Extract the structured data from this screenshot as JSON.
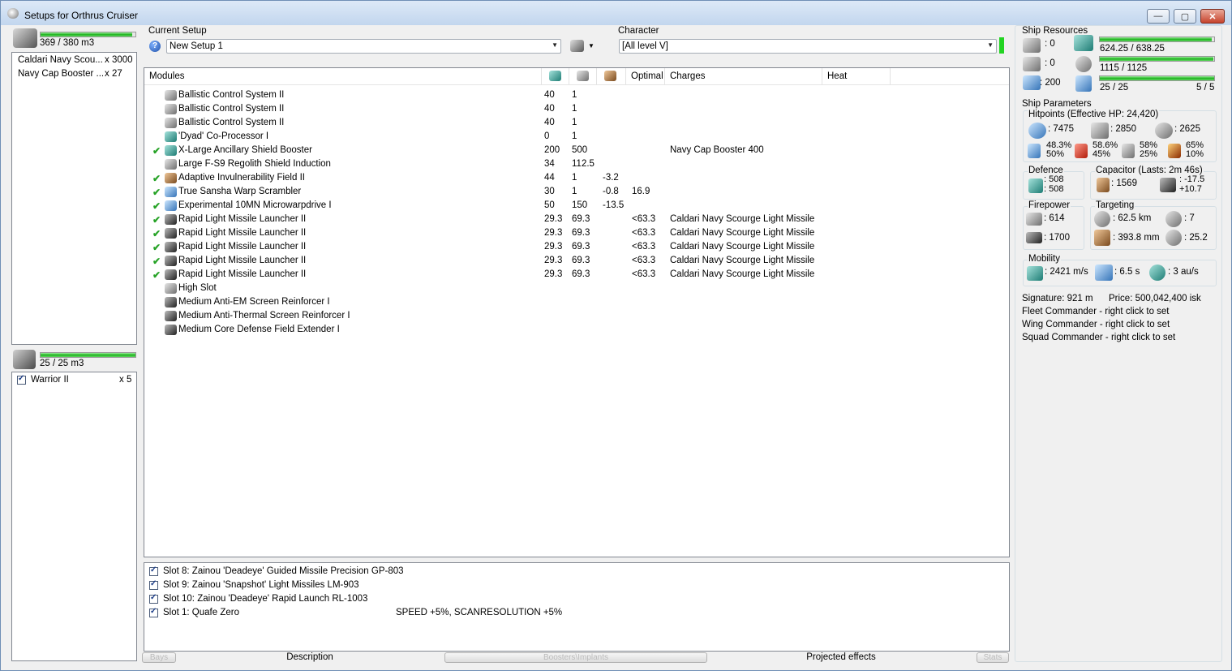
{
  "window": {
    "title": "Setups for Orthrus Cruiser",
    "minimize": "—",
    "maximize": "▢",
    "close": "✕"
  },
  "cargo": {
    "capacity": "369 / 380 m3",
    "fill_pct": 97,
    "items": [
      {
        "name": "Caldari Navy Scou...",
        "qty": "x 3000"
      },
      {
        "name": "Navy Cap Booster ...",
        "qty": "x 27"
      }
    ]
  },
  "drone_bay": {
    "capacity": "25 / 25 m3",
    "fill_pct": 100,
    "items": [
      {
        "name": "Warrior II",
        "qty": "x 5"
      }
    ]
  },
  "setup": {
    "label": "Current Setup",
    "value": "New Setup 1"
  },
  "character": {
    "label": "Character",
    "value": "[All level V]"
  },
  "modules": {
    "headers": {
      "modules": "Modules",
      "optimal": "Optimal",
      "charges": "Charges",
      "heat": "Heat"
    },
    "rows": [
      {
        "check": "",
        "icon": "ballistic-control-icon",
        "name": "Ballistic Control System II",
        "cpu": "40",
        "pg": "1",
        "cap": "",
        "optimal": "",
        "charges": ""
      },
      {
        "check": "",
        "icon": "ballistic-control-icon",
        "name": "Ballistic Control System II",
        "cpu": "40",
        "pg": "1",
        "cap": "",
        "optimal": "",
        "charges": ""
      },
      {
        "check": "",
        "icon": "ballistic-control-icon",
        "name": "Ballistic Control System II",
        "cpu": "40",
        "pg": "1",
        "cap": "",
        "optimal": "",
        "charges": ""
      },
      {
        "check": "",
        "icon": "co-processor-icon",
        "name": "'Dyad' Co-Processor I",
        "cpu": "0",
        "pg": "1",
        "cap": "",
        "optimal": "",
        "charges": ""
      },
      {
        "check": "✔",
        "icon": "shield-booster-icon",
        "name": "X-Large Ancillary Shield Booster",
        "cpu": "200",
        "pg": "500",
        "cap": "",
        "optimal": "",
        "charges": "Navy Cap Booster 400"
      },
      {
        "check": "",
        "icon": "shield-induction-icon",
        "name": "Large F-S9 Regolith Shield Induction",
        "cpu": "34",
        "pg": "112.5",
        "cap": "",
        "optimal": "",
        "charges": ""
      },
      {
        "check": "✔",
        "icon": "invulnerability-field-icon",
        "name": "Adaptive Invulnerability Field II",
        "cpu": "44",
        "pg": "1",
        "cap": "-3.2",
        "optimal": "",
        "charges": ""
      },
      {
        "check": "✔",
        "icon": "warp-scrambler-icon",
        "name": "True Sansha Warp Scrambler",
        "cpu": "30",
        "pg": "1",
        "cap": "-0.8",
        "optimal": "16.9",
        "charges": ""
      },
      {
        "check": "✔",
        "icon": "microwarpdrive-icon",
        "name": "Experimental 10MN Microwarpdrive I",
        "cpu": "50",
        "pg": "150",
        "cap": "-13.5",
        "optimal": "",
        "charges": ""
      },
      {
        "check": "✔",
        "icon": "missile-launcher-icon",
        "name": "Rapid Light Missile Launcher II",
        "cpu": "29.3",
        "pg": "69.3",
        "cap": "",
        "optimal": "<63.3",
        "charges": "Caldari Navy Scourge Light Missile"
      },
      {
        "check": "✔",
        "icon": "missile-launcher-icon",
        "name": "Rapid Light Missile Launcher II",
        "cpu": "29.3",
        "pg": "69.3",
        "cap": "",
        "optimal": "<63.3",
        "charges": "Caldari Navy Scourge Light Missile"
      },
      {
        "check": "✔",
        "icon": "missile-launcher-icon",
        "name": "Rapid Light Missile Launcher II",
        "cpu": "29.3",
        "pg": "69.3",
        "cap": "",
        "optimal": "<63.3",
        "charges": "Caldari Navy Scourge Light Missile"
      },
      {
        "check": "✔",
        "icon": "missile-launcher-icon",
        "name": "Rapid Light Missile Launcher II",
        "cpu": "29.3",
        "pg": "69.3",
        "cap": "",
        "optimal": "<63.3",
        "charges": "Caldari Navy Scourge Light Missile"
      },
      {
        "check": "✔",
        "icon": "missile-launcher-icon",
        "name": "Rapid Light Missile Launcher II",
        "cpu": "29.3",
        "pg": "69.3",
        "cap": "",
        "optimal": "<63.3",
        "charges": "Caldari Navy Scourge Light Missile"
      },
      {
        "check": "",
        "icon": "high-slot-icon",
        "name": "High Slot",
        "cpu": "",
        "pg": "",
        "cap": "",
        "optimal": "",
        "charges": ""
      },
      {
        "check": "",
        "icon": "screen-reinforcer-icon",
        "name": "Medium Anti-EM Screen Reinforcer I",
        "cpu": "",
        "pg": "",
        "cap": "",
        "optimal": "",
        "charges": ""
      },
      {
        "check": "",
        "icon": "screen-reinforcer-icon",
        "name": "Medium Anti-Thermal Screen Reinforcer I",
        "cpu": "",
        "pg": "",
        "cap": "",
        "optimal": "",
        "charges": ""
      },
      {
        "check": "",
        "icon": "screen-reinforcer-icon",
        "name": "Medium Core Defense Field Extender I",
        "cpu": "",
        "pg": "",
        "cap": "",
        "optimal": "",
        "charges": ""
      }
    ]
  },
  "boosters": [
    {
      "name": "Slot 8: Zainou 'Deadeye' Guided Missile Precision GP-803",
      "effect": ""
    },
    {
      "name": "Slot 9: Zainou 'Snapshot' Light Missiles LM-903",
      "effect": ""
    },
    {
      "name": "Slot 10: Zainou 'Deadeye' Rapid Launch RL-1003",
      "effect": ""
    },
    {
      "name": "Slot 1: Quafe Zero",
      "effect": "SPEED +5%, SCANRESOLUTION +5%"
    }
  ],
  "tabs": {
    "bays": "Bays",
    "description": "Description",
    "boosters_implants": "Boosters\\Implants",
    "projected": "Projected effects",
    "stats": "Stats"
  },
  "resources": {
    "label": "Ship Resources",
    "turret_hardpoints": ": 0",
    "launcher_hardpoints": ": 0",
    "calibration": ": 200",
    "cpu": "624.25 / 638.25",
    "cpu_pct": 98,
    "powergrid": "1115 / 1125",
    "pg_pct": 99,
    "drone_bw": "25 / 25",
    "drone_bw_pct": 100,
    "drones_active": "5 / 5"
  },
  "params": {
    "label": "Ship Parameters",
    "hitpoints_label": "Hitpoints (Effective HP: 24,420)",
    "shield_hp": ": 7475",
    "armor_hp": ": 2850",
    "structure_hp": ": 2625",
    "resists": [
      {
        "icon": "em-resist-icon",
        "top": "48.3%",
        "bottom": "50%"
      },
      {
        "icon": "thermal-resist-icon",
        "top": "58.6%",
        "bottom": "45%"
      },
      {
        "icon": "kinetic-resist-icon",
        "top": "58%",
        "bottom": "25%"
      },
      {
        "icon": "explosive-resist-icon",
        "top": "65%",
        "bottom": "10%"
      }
    ],
    "defence_label": "Defence",
    "defence_top": ": 508",
    "defence_bottom": ": 508",
    "capacitor_label": "Capacitor (Lasts: 2m 46s)",
    "capacitor_amount": ": 1569",
    "capacitor_delta_top": ": -17.5",
    "capacitor_delta_bottom": "+10.7",
    "firepower_label": "Firepower",
    "dps": ": 614",
    "volley": ": 1700",
    "targeting_label": "Targeting",
    "target_range": ": 62.5 km",
    "max_targets": ": 7",
    "scan_res": ": 393.8 mm",
    "sensor_strength": ": 25.2",
    "mobility_label": "Mobility",
    "speed": ": 2421 m/s",
    "align_time": ": 6.5 s",
    "warp_speed": ": 3 au/s",
    "signature": "Signature: 921 m",
    "price": "Price: 500,042,400 isk",
    "fleet_commander": "Fleet Commander - right click to set",
    "wing_commander": "Wing Commander - right click to set",
    "squad_commander": "Squad Commander - right click to set"
  }
}
